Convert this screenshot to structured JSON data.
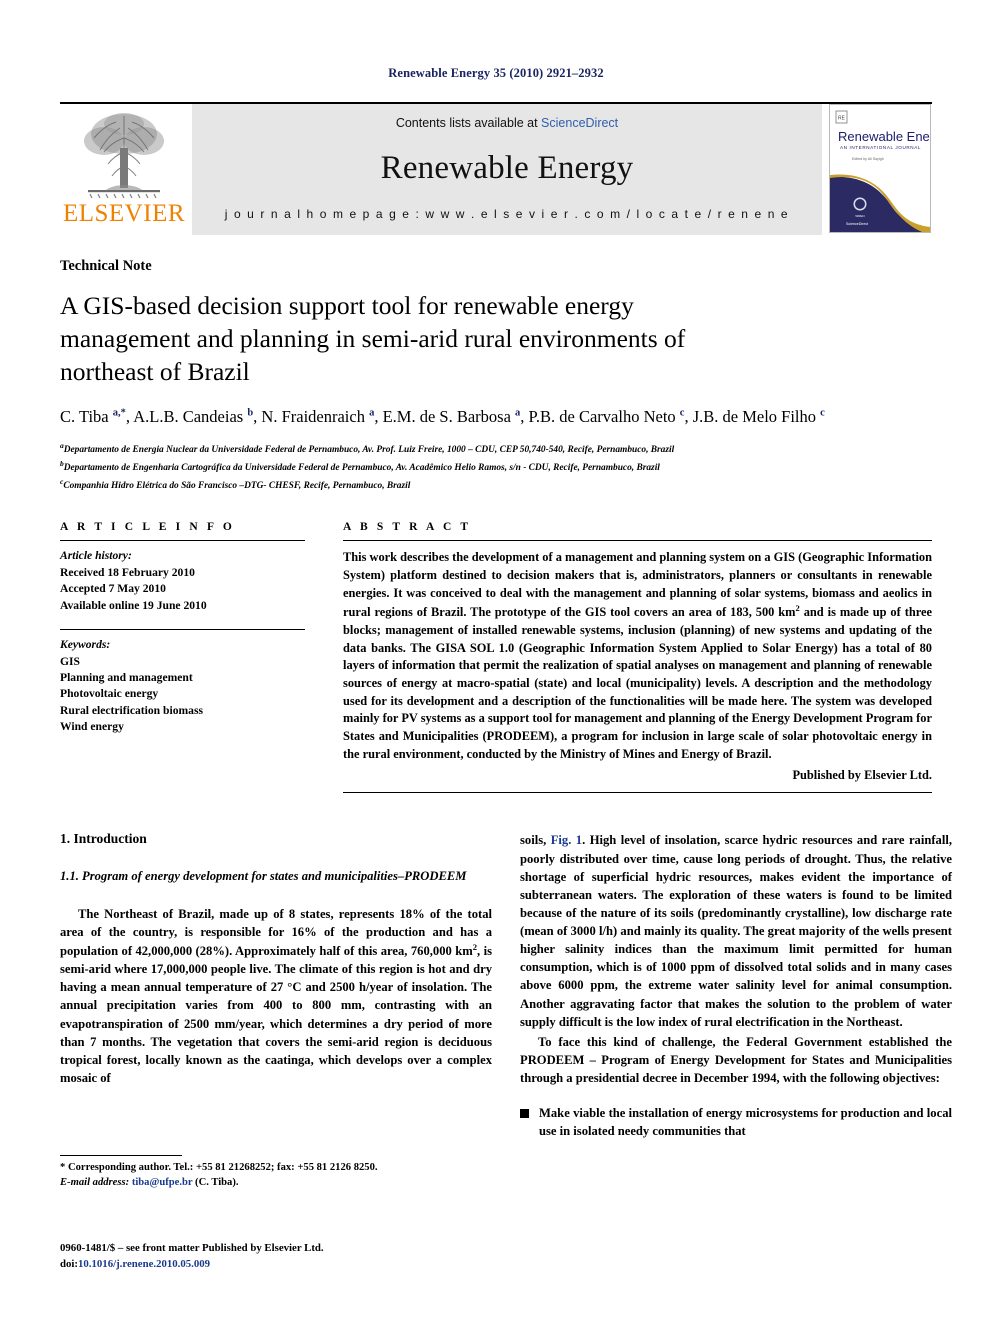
{
  "running_head": "Renewable Energy 35 (2010) 2921–2932",
  "masthead": {
    "publisher_wordmark": "ELSEVIER",
    "contents_prefix": "Contents lists available at ",
    "contents_link": "ScienceDirect",
    "journal_name": "Renewable Energy",
    "homepage": "j o u r n a l   h o m e p a g e :   w w w . e l s e v i e r . c o m / l o c a t e / r e n e n e",
    "cover": {
      "title": "Renewable Energy",
      "subtitle": "AN INTERNATIONAL JOURNAL",
      "footer": "ScienceDirect"
    }
  },
  "article": {
    "type": "Technical Note",
    "title": "A GIS-based decision support tool for renewable energy management and planning in semi-arid rural environments of northeast of Brazil",
    "authors_html": "C. Tiba <sup>a,*</sup>, A.L.B. Candeias <sup>b</sup>, N. Fraidenraich <sup>a</sup>, E.M. de S. Barbosa <sup>a</sup>, P.B. de Carvalho Neto <sup>c</sup>, J.B. de Melo Filho <sup>c</sup>",
    "affiliations": [
      {
        "marker": "a",
        "text": "Departamento de Energia Nuclear da Universidade Federal de Pernambuco, Av. Prof. Luiz Freire, 1000 – CDU, CEP 50,740-540, Recife, Pernambuco, Brazil"
      },
      {
        "marker": "b",
        "text": "Departamento de Engenharia Cartográfica da Universidade Federal de Pernambuco, Av. Acadêmico Helio Ramos, s/n - CDU, Recife, Pernambuco, Brazil"
      },
      {
        "marker": "c",
        "text": "Companhia Hidro Elétrica do São Francisco –DTG- CHESF, Recife, Pernambuco, Brazil"
      }
    ]
  },
  "article_info": {
    "heading": "A R T I C L E  I N F O",
    "history_label": "Article history:",
    "history": [
      "Received 18 February 2010",
      "Accepted 7 May 2010",
      "Available online 19 June 2010"
    ],
    "keywords_label": "Keywords:",
    "keywords": [
      "GIS",
      "Planning and management",
      "Photovoltaic energy",
      "Rural electrification biomass",
      "Wind energy"
    ]
  },
  "abstract": {
    "heading": "A B S T R A C T",
    "paragraph_html": "This work describes the development of a management and planning system on a GIS (Geographic Information System) platform destined to decision makers that is, administrators, planners or consultants in renewable energies. It was conceived to deal with the management and planning of solar systems, biomass and aeolics in rural regions of Brazil. The prototype of the GIS tool covers an area of 183, 500 km<sup>2</sup> and is made up of three blocks; management of installed renewable systems, inclusion (planning) of new systems and updating of the data banks. The GISA SOL 1.0 (Geographic Information System Applied to Solar Energy) has a total of 80 layers of information that permit the realization of spatial analyses on management and planning of renewable sources of energy at macro-spatial (state) and local (municipality) levels. A description and the methodology used for its development and a description of the functionalities will be made here. The system was developed mainly for PV systems as a support tool for management and planning of the Energy Development Program for States and Municipalities (PRODEEM), a program for inclusion in large scale of solar photovoltaic energy in the rural environment, conducted by the Ministry of Mines and Energy of Brazil.",
    "publisher_line": "Published by Elsevier Ltd."
  },
  "body": {
    "section_number_title": "1.  Introduction",
    "subsection_title": "1.1.  Program of energy development for states and municipalities–PRODEEM",
    "left_paragraph_html": "The Northeast of Brazil, made up of 8 states, represents 18% of the total area of the country, is responsible for 16% of the production and has a population of 42,000,000 (28%). Approximately half of this area, 760,000 km<sup>2</sup>, is semi-arid where 17,000,000 people live. The climate of this region is hot and dry having a mean annual temperature of 27 °C and 2500 h/year of insolation. The annual precipitation varies from 400 to 800 mm, contrasting with an evapotranspiration of 2500 mm/year, which determines a dry period of more than 7 months. The vegetation that covers the semi-arid region is deciduous tropical forest, locally known as the caatinga, which develops over a complex mosaic of",
    "right_paragraph_1_html": "soils, <span class=\"link\">Fig. 1</span>. High level of insolation, scarce hydric resources and rare rainfall, poorly distributed over time, cause long periods of drought. Thus, the relative shortage of superficial hydric resources, makes evident the importance of subterranean waters. The exploration of these waters is found to be limited because of the nature of its soils (predominantly crystalline), low discharge rate (mean of 3000 l/h) and mainly its quality. The great majority of the wells present higher salinity indices than the maximum limit permitted for human consumption, which is of 1000 ppm of dissolved total solids and in many cases above 6000 ppm, the extreme water salinity level for animal consumption. Another aggravating factor that makes the solution to the problem of water supply difficult is the low index of rural electrification in the Northeast.",
    "right_paragraph_2_html": "To face this kind of challenge, the Federal Government established the PRODEEM – Program of Energy Development for States and Municipalities through a presidential decree in December 1994, with the following objectives:",
    "bullet_1": "Make viable the installation of energy microsystems for production and local use in isolated needy communities that"
  },
  "footnotes": {
    "corresponding_html": "* Corresponding author. Tel.: +55 81 21268252; fax: +55 81 2126 8250.",
    "email_label": "E-mail address:",
    "email_link": "tiba@ufpe.br",
    "email_suffix": " (C. Tiba).",
    "issn_line": "0960-1481/$ – see front matter Published by Elsevier Ltd.",
    "doi_label": "doi:",
    "doi_link": "10.1016/j.renene.2010.05.009"
  },
  "colors": {
    "running_head": "#1a2463",
    "elsevier_orange": "#f08000",
    "link_blue": "#1a3a8f",
    "sciencedirect_blue": "#2d5faa",
    "band_gray": "#e6e6e6"
  }
}
